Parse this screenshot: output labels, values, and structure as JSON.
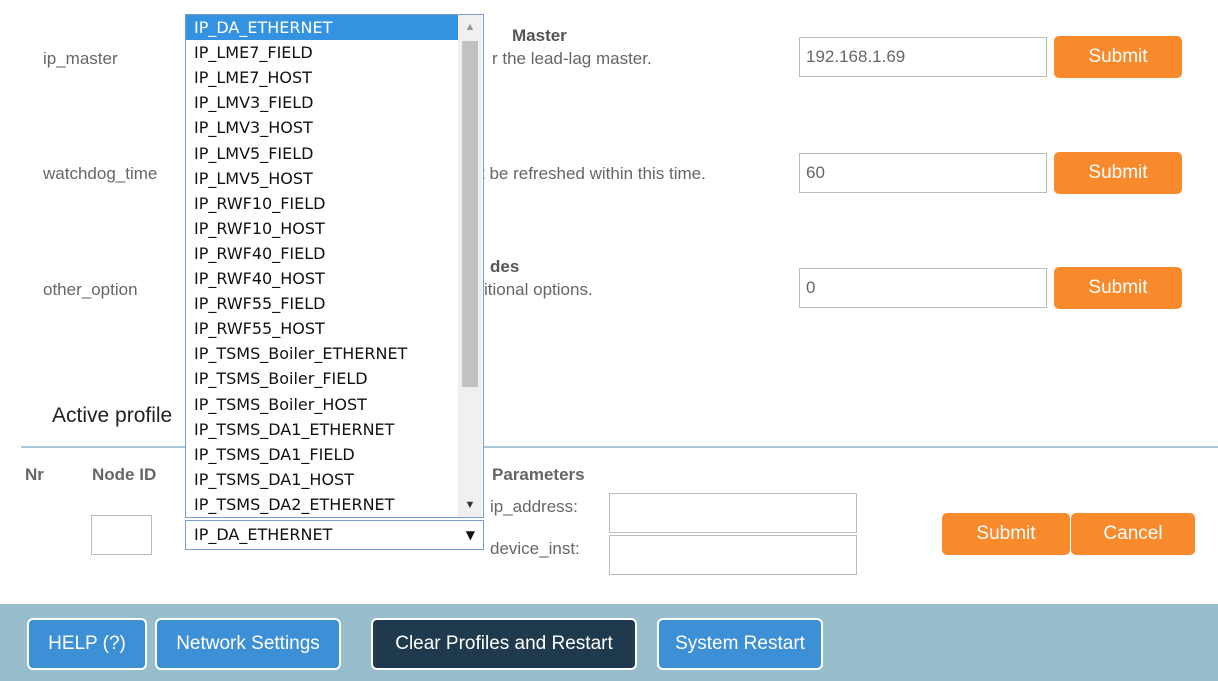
{
  "settings": [
    {
      "label": "ip_master",
      "desc_title": "Master",
      "desc_text": "r the lead-lag master.",
      "value": "192.168.1.69",
      "submit": "Submit"
    },
    {
      "label": "watchdog_time",
      "desc_title": "",
      "desc_text": "t be refreshed within this time.",
      "value": "60",
      "submit": "Submit"
    },
    {
      "label": "other_option",
      "desc_title": "des",
      "desc_text": "itional options.",
      "value": "0",
      "submit": "Submit"
    }
  ],
  "active_profiles_title": "Active profile",
  "table_headers": {
    "nr": "Nr",
    "node_id": "Node ID",
    "parameters": "Parameters"
  },
  "parameters": {
    "ip_address_label": "ip_address:",
    "device_inst_label": "device_inst:"
  },
  "profile_form": {
    "submit": "Submit",
    "cancel": "Cancel"
  },
  "dropdown": {
    "selected": "IP_DA_ETHERNET",
    "options": [
      "IP_DA_ETHERNET",
      "IP_LME7_FIELD",
      "IP_LME7_HOST",
      "IP_LMV3_FIELD",
      "IP_LMV3_HOST",
      "IP_LMV5_FIELD",
      "IP_LMV5_HOST",
      "IP_RWF10_FIELD",
      "IP_RWF10_HOST",
      "IP_RWF40_FIELD",
      "IP_RWF40_HOST",
      "IP_RWF55_FIELD",
      "IP_RWF55_HOST",
      "IP_TSMS_Boiler_ETHERNET",
      "IP_TSMS_Boiler_FIELD",
      "IP_TSMS_Boiler_HOST",
      "IP_TSMS_DA1_ETHERNET",
      "IP_TSMS_DA1_FIELD",
      "IP_TSMS_DA1_HOST",
      "IP_TSMS_DA2_ETHERNET"
    ]
  },
  "footer": {
    "help": "HELP (?)",
    "network": "Network Settings",
    "clear": "Clear Profiles and Restart",
    "restart": "System Restart"
  },
  "colors": {
    "accent": "#f98a2c",
    "footer_bg": "#97bccc",
    "blue_button": "#3d8fd6",
    "dark_button": "#1e3a4c",
    "selected_option": "#3393e0"
  }
}
